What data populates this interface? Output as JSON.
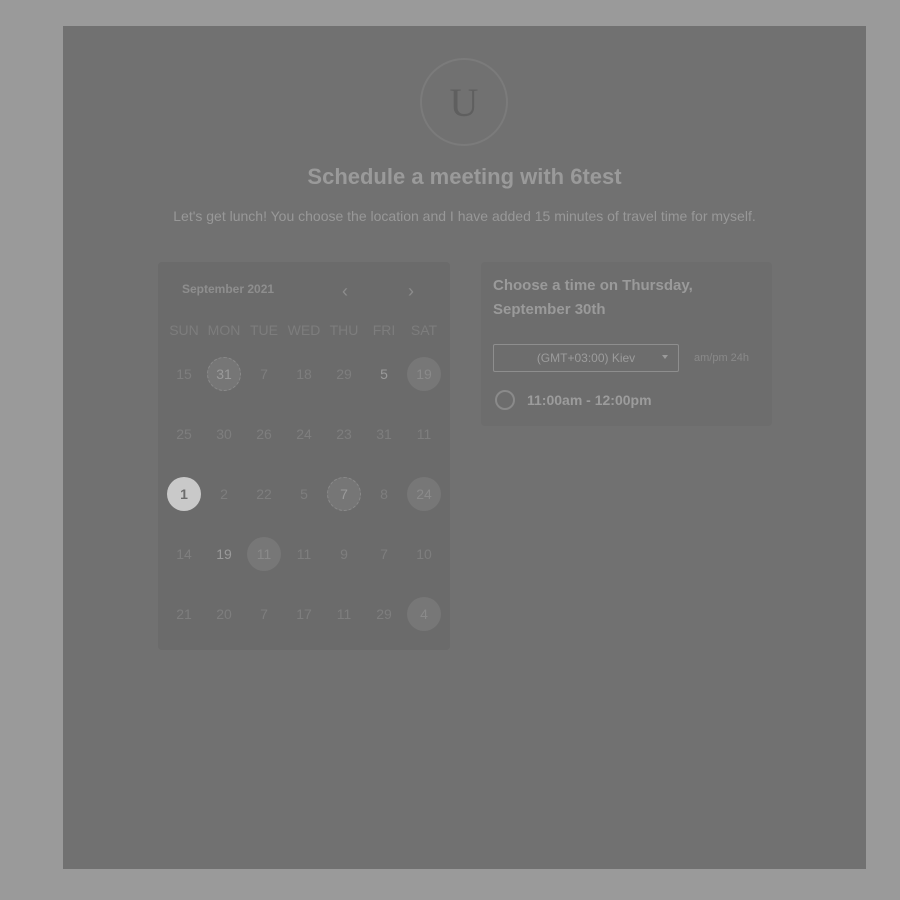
{
  "header": {
    "avatar_letter": "U",
    "title": "Schedule a meeting with 6test",
    "subtitle": "Let's get lunch! You choose the location and I have added 15 minutes of travel time for myself."
  },
  "calendar": {
    "month_label": "September 2021",
    "prev_icon": "chevron-left-icon",
    "next_icon": "chevron-right-icon",
    "weekdays": [
      "SUN",
      "MON",
      "TUE",
      "WED",
      "THU",
      "FRI",
      "SAT"
    ],
    "weeks": [
      [
        {
          "t": "15"
        },
        {
          "t": "31",
          "s": "ring"
        },
        {
          "t": "7"
        },
        {
          "t": "18"
        },
        {
          "t": "29"
        },
        {
          "t": "5",
          "s": "bright"
        },
        {
          "t": "19",
          "s": "avail"
        }
      ],
      [
        {
          "t": "25"
        },
        {
          "t": "30"
        },
        {
          "t": "26"
        },
        {
          "t": "24"
        },
        {
          "t": "23"
        },
        {
          "t": "31"
        },
        {
          "t": "11"
        }
      ],
      [
        {
          "t": "1",
          "s": "sel"
        },
        {
          "t": "2"
        },
        {
          "t": "22"
        },
        {
          "t": "5"
        },
        {
          "t": "7",
          "s": "ring"
        },
        {
          "t": "8"
        },
        {
          "t": "24",
          "s": "avail"
        }
      ],
      [
        {
          "t": "14"
        },
        {
          "t": "19",
          "s": "bright"
        },
        {
          "t": "11",
          "s": "avail"
        },
        {
          "t": "11"
        },
        {
          "t": "9"
        },
        {
          "t": "7"
        },
        {
          "t": "10"
        }
      ],
      [
        {
          "t": "21"
        },
        {
          "t": "20"
        },
        {
          "t": "7"
        },
        {
          "t": "17"
        },
        {
          "t": "11"
        },
        {
          "t": "29"
        },
        {
          "t": "4",
          "s": "avail"
        }
      ]
    ]
  },
  "time_panel": {
    "heading": "Choose a time on Thursday, September 30th",
    "timezone": "(GMT+03:00) Kiev",
    "format_toggle": "am/pm  24h",
    "slots": [
      "11:00am - 12:00pm"
    ]
  }
}
